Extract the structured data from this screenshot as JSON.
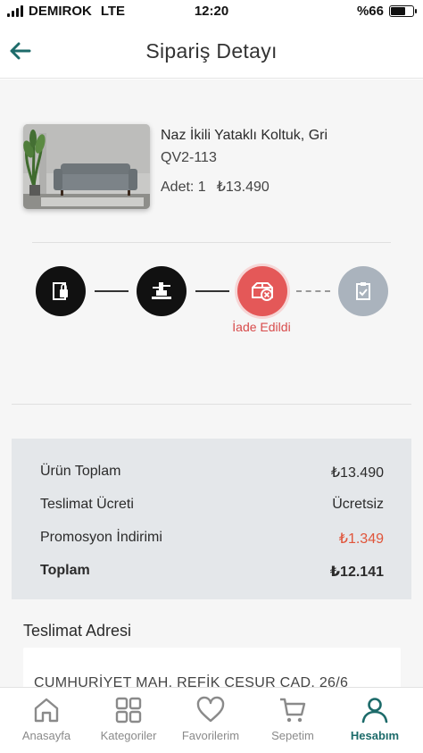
{
  "status_bar": {
    "carrier": "DEMIROK",
    "network": "LTE",
    "time": "12:20",
    "battery": "%66",
    "battery_level": 0.66
  },
  "header": {
    "title": "Sipariş Detayı",
    "back_icon": "arrow-left-icon",
    "accent": "#1d6b6a"
  },
  "product": {
    "name": "Naz İkili Yataklı Koltuk, Gri",
    "code": "QV2-113",
    "quantity": "Adet: 1",
    "price": "₺13.490"
  },
  "tracking": {
    "steps": [
      {
        "icon": "package-lock-icon",
        "state": "done"
      },
      {
        "icon": "shipping-station-icon",
        "state": "done"
      },
      {
        "icon": "box-cancel-icon",
        "state": "current",
        "label": "İade Edildi"
      },
      {
        "icon": "clipboard-check-icon",
        "state": "pending"
      }
    ],
    "colors": {
      "done": "#111111",
      "current": "#e45858",
      "pending": "#aab3bd"
    }
  },
  "summary": {
    "rows": [
      {
        "label": "Ürün Toplam",
        "value": "₺13.490"
      },
      {
        "label": "Teslimat Ücreti",
        "value": "Ücretsiz"
      },
      {
        "label": "Promosyon İndirimi",
        "value": "₺1.349"
      },
      {
        "label": "Toplam",
        "value": "₺12.141"
      }
    ],
    "discount_color": "#e0553b"
  },
  "address": {
    "title": "Teslimat Adresi",
    "line": "CUMHURİYET MAH. REFİK CESUR CAD. 26/6"
  },
  "bottom_nav": {
    "items": [
      {
        "label": "Anasayfa",
        "icon": "home-icon"
      },
      {
        "label": "Kategoriler",
        "icon": "grid-icon"
      },
      {
        "label": "Favorilerim",
        "icon": "heart-icon"
      },
      {
        "label": "Sepetim",
        "icon": "cart-icon"
      },
      {
        "label": "Hesabım",
        "icon": "user-icon",
        "active": true
      }
    ]
  }
}
